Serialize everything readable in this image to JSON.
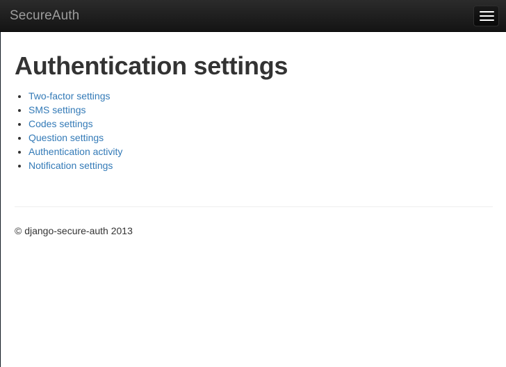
{
  "navbar": {
    "brand": "SecureAuth",
    "toggle_icon": "hamburger-icon",
    "background_color": "#1c1c1c",
    "brand_color": "#9d9d9d"
  },
  "main": {
    "title": "Authentication settings",
    "links": [
      {
        "label": "Two-factor settings"
      },
      {
        "label": "SMS settings"
      },
      {
        "label": "Codes settings"
      },
      {
        "label": "Question settings"
      },
      {
        "label": "Authentication activity"
      },
      {
        "label": "Notification settings"
      }
    ],
    "link_color": "#337ab7"
  },
  "footer": {
    "text": "© django-secure-auth 2013"
  }
}
